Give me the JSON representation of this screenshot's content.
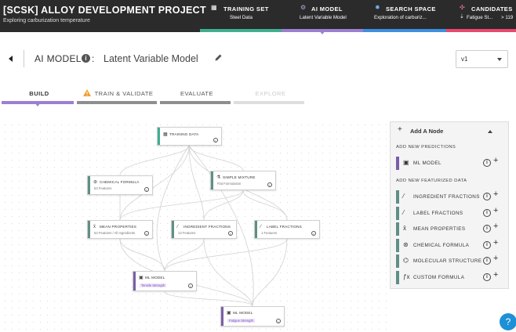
{
  "header": {
    "project_title": "[SCSK] ALLOY DEVELOPMENT PROJECT",
    "project_subtitle": "Exploring carburization temperature",
    "tabs": [
      {
        "label": "TRAINING SET",
        "sub": "Steel Data",
        "color": "#3fae8e",
        "icon": "table-icon"
      },
      {
        "label": "AI MODEL",
        "sub": "Latent Variable Model",
        "color": "#9b7fd1",
        "icon": "ai-model-icon"
      },
      {
        "label": "SEARCH SPACE",
        "sub": "Exploration of carburiz...",
        "color": "#3d8fe0",
        "icon": "search-space-icon"
      },
      {
        "label": "CANDIDATES",
        "sub": "Fatigue St...",
        "sub_extra": "> 119",
        "color": "#e8476f",
        "icon": "candidates-icon"
      }
    ]
  },
  "model_header": {
    "type_label": "AI MODEL",
    "info_glyph": "i",
    "colon": ":",
    "name": "Latent Variable Model",
    "version": "v1"
  },
  "steps": [
    {
      "label": "BUILD",
      "state": "active",
      "color": "#9b7fd1"
    },
    {
      "label": "TRAIN & VALIDATE",
      "state": "warning",
      "color": "#8f8f8f"
    },
    {
      "label": "EVALUATE",
      "state": "normal",
      "color": "#8f8f8f"
    },
    {
      "label": "EXPLORE",
      "state": "disabled",
      "color": "#dedede"
    }
  ],
  "nodes": {
    "training_data": {
      "title": "TRAINING DATA",
      "icon": "table-icon",
      "stripe": "#3fae8e"
    },
    "chemical_formula": {
      "title": "CHEMICAL FORMULA",
      "sub": "53 Features",
      "icon": "atom-icon",
      "stripe": "#5f8f85"
    },
    "simple_mixture": {
      "title": "SIMPLE MIXTURE",
      "sub": "Flat Formulation",
      "icon": "mixture-icon",
      "stripe": "#5f8f85"
    },
    "mean_properties": {
      "title": "MEAN PROPERTIES",
      "sub": "53 Features / All Ingredients",
      "icon": "mean-icon",
      "stripe": "#5f8f85"
    },
    "ingredient_fractions": {
      "title": "INGREDIENT FRACTIONS",
      "sub": "13 Features",
      "icon": "fraction-icon",
      "stripe": "#5f8f85"
    },
    "label_fractions": {
      "title": "LABEL FRACTIONS",
      "sub": "1 Features",
      "icon": "fraction-icon",
      "stripe": "#5f8f85"
    },
    "ml_model_1": {
      "title": "ML MODEL",
      "sub": "Tensile Strength",
      "icon": "model-icon",
      "stripe": "#7a5ea8"
    },
    "ml_model_2": {
      "title": "ML MODEL",
      "sub": "Fatigue Strength",
      "icon": "model-icon",
      "stripe": "#7a5ea8"
    }
  },
  "panel": {
    "header": "Add A Node",
    "section_predictions": "ADD NEW PREDICTIONS",
    "section_featurized": "ADD NEW FEATURIZED DATA",
    "prediction_items": [
      {
        "label": "ML MODEL",
        "icon": "model-icon",
        "color": "#7a5ea8"
      }
    ],
    "featurized_items": [
      {
        "label": "INGREDIENT FRACTIONS",
        "icon": "fraction-icon",
        "color": "#5f8f85"
      },
      {
        "label": "LABEL FRACTIONS",
        "icon": "fraction-icon",
        "color": "#5f8f85"
      },
      {
        "label": "MEAN PROPERTIES",
        "icon": "mean-icon",
        "color": "#5f8f85"
      },
      {
        "label": "CHEMICAL FORMULA",
        "icon": "atom-icon",
        "color": "#5f8f85"
      },
      {
        "label": "MOLECULAR STRUCTURE",
        "icon": "molecule-icon",
        "color": "#5f8f85"
      },
      {
        "label": "CUSTOM FORMULA",
        "icon": "formula-icon",
        "color": "#5f8f85"
      }
    ],
    "info_glyph": "i",
    "add_glyph": "+"
  },
  "help_glyph": "?"
}
